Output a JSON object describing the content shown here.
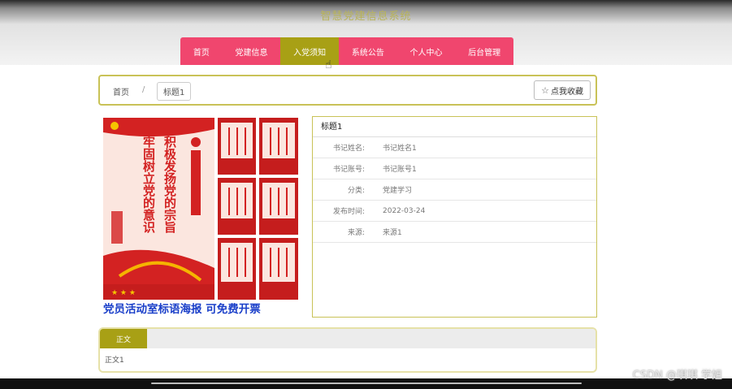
{
  "site": {
    "title": "智慧党建信息系统"
  },
  "nav": {
    "items": [
      {
        "label": "首页"
      },
      {
        "label": "党建信息"
      },
      {
        "label": "入党须知"
      },
      {
        "label": "系统公告"
      },
      {
        "label": "个人中心"
      },
      {
        "label": "后台管理"
      }
    ],
    "active_index": 2
  },
  "breadcrumb": {
    "home": "首页",
    "separator": "/",
    "current": "标题1"
  },
  "favorite": {
    "icon": "star-outline-icon",
    "label": "点我收藏"
  },
  "poster": {
    "headline_left": "牢固树立党的意识",
    "headline_right": "积极发扬党的宗旨",
    "banner_text": "党员活动室标语海报  可免费开票"
  },
  "detail": {
    "title": "标题1",
    "rows": [
      {
        "label": "书记姓名:",
        "value": "书记姓名1"
      },
      {
        "label": "书记账号:",
        "value": "书记账号1"
      },
      {
        "label": "分类:",
        "value": "党建学习"
      },
      {
        "label": "发布时间:",
        "value": "2022-03-24"
      },
      {
        "label": "来源:",
        "value": "来源1"
      }
    ]
  },
  "content": {
    "tab_label": "正文",
    "text": "正文1"
  },
  "watermark": "CSDN @琪琪 学姐",
  "colors": {
    "nav_bg": "#f0466e",
    "accent": "#a8a015",
    "border": "#c9c257",
    "poster_red": "#d32222"
  }
}
